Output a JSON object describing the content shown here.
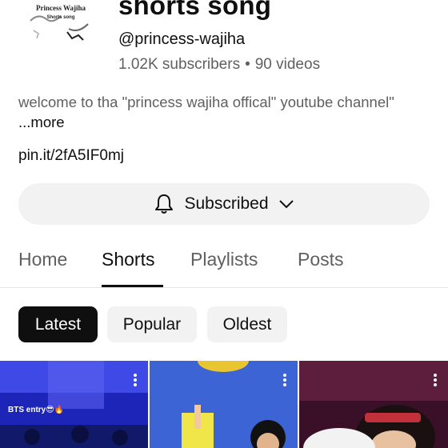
{
  "channel": {
    "title": "shorts song",
    "handle": "@princess-wajiha",
    "subscribers": "1.02K subscribers",
    "separator": "•",
    "videos": "90 videos",
    "avatar_text_line1": "Princess Wajiha",
    "avatar_text_line2": "Shorts song"
  },
  "description": {
    "text": "welcome to tha \"princess wajiha offical\" youtube channel\"",
    "more_label": "...more"
  },
  "link": "pin.it/2fA5IF0mj",
  "subscribe_button": {
    "label": "Subscribed",
    "icon": "bell-icon",
    "dropdown_icon": "chevron-down-icon"
  },
  "tabs": [
    {
      "label": "Home",
      "active": false
    },
    {
      "label": "Shorts",
      "active": true
    },
    {
      "label": "Playlists",
      "active": false
    },
    {
      "label": "Posts",
      "active": false
    }
  ],
  "filters": [
    {
      "label": "Latest",
      "active": true
    },
    {
      "label": "Popular",
      "active": false
    },
    {
      "label": "Oldest",
      "active": false
    }
  ],
  "shorts": [
    {
      "overlay_text": "BTS entry😎🔥",
      "accent": "#2a3bd6"
    },
    {
      "overlay_text": "",
      "accent": "#4a6fd8"
    },
    {
      "overlay_text": "",
      "accent": "#6a2a3c"
    }
  ]
}
